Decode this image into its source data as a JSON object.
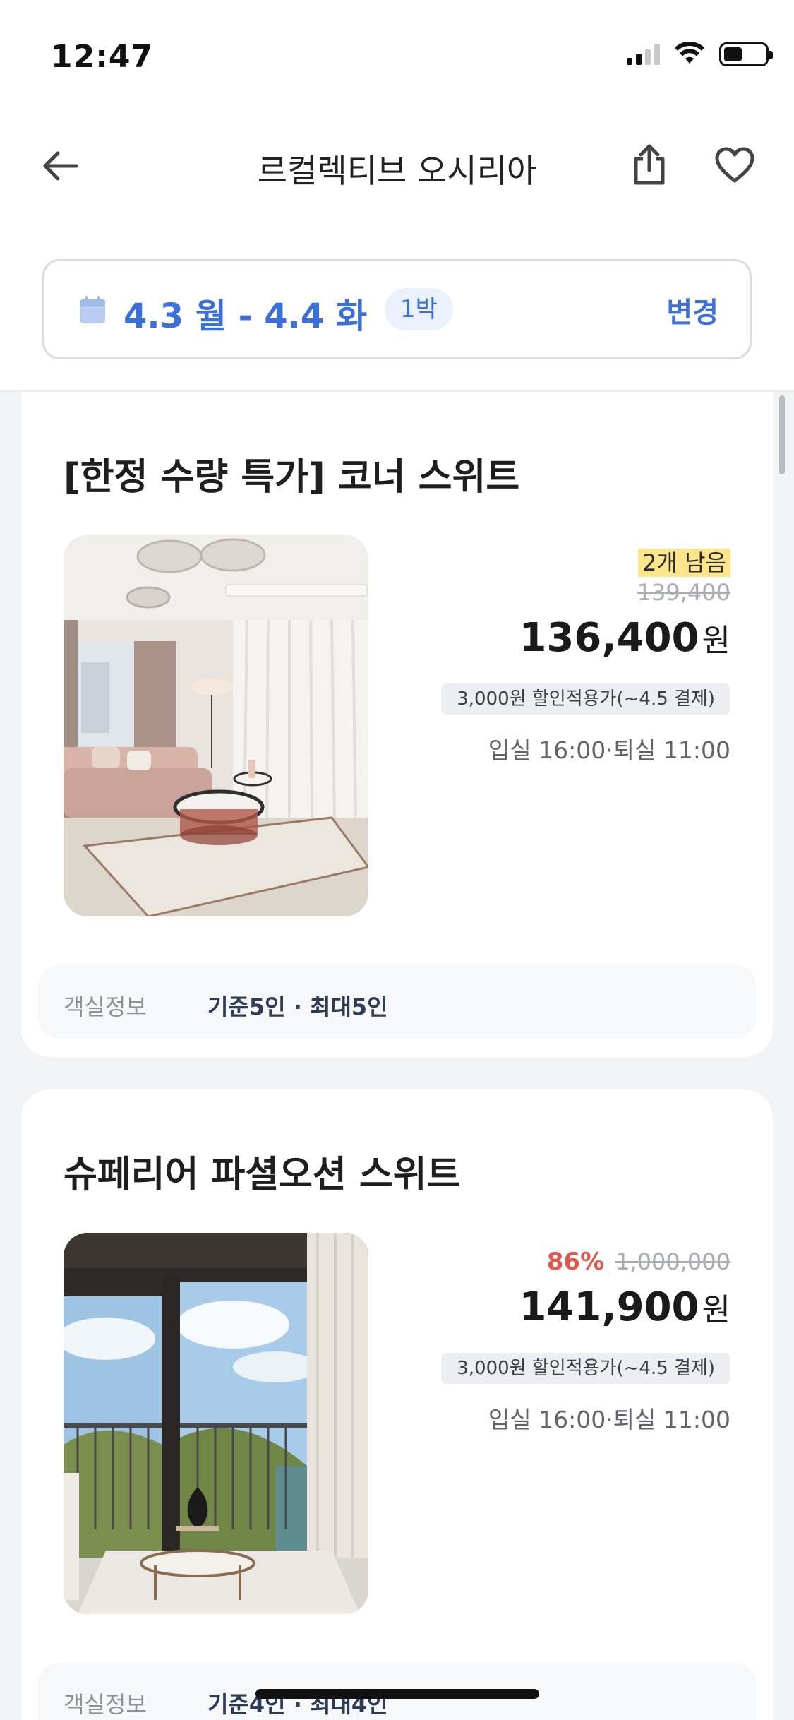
{
  "status_bar": {
    "time": "12:47",
    "signal_bars_active": 2,
    "signal_bars_total": 4,
    "battery_level": 0.45
  },
  "nav": {
    "title": "르컬렉티브 오시리아",
    "back_icon": "arrow-left-icon",
    "share_icon": "share-icon",
    "favorite_icon": "heart-icon"
  },
  "date_bar": {
    "dates": "4.3 월 - 4.4 화",
    "nights": "1박",
    "change_label": "변경",
    "calendar_icon": "calendar-icon",
    "accent_color": "#3b6fd9"
  },
  "rooms": [
    {
      "name": "[한정 수량 특가] 코너 스위트",
      "remaining": "2개 남음",
      "original_price": "139,400",
      "price": "136,400",
      "currency": "원",
      "coupon": "3,000원 할인적용가(~4.5 결제)",
      "checkin_checkout": "입실 16:00·퇴실 11:00",
      "info_label": "객실정보",
      "info_value": "기준5인 · 최대5인"
    },
    {
      "name": "슈페리어 파셜오션 스위트",
      "discount_rate": "86%",
      "original_price": "1,000,000",
      "price": "141,900",
      "currency": "원",
      "coupon": "3,000원 할인적용가(~4.5 결제)",
      "checkin_checkout": "입실 16:00·퇴실 11:00",
      "info_label": "객실정보",
      "info_value": "기준4인 · 최대4인"
    }
  ],
  "colors": {
    "discount_red": "#e2574c",
    "remaining_badge": "#fde58b"
  }
}
